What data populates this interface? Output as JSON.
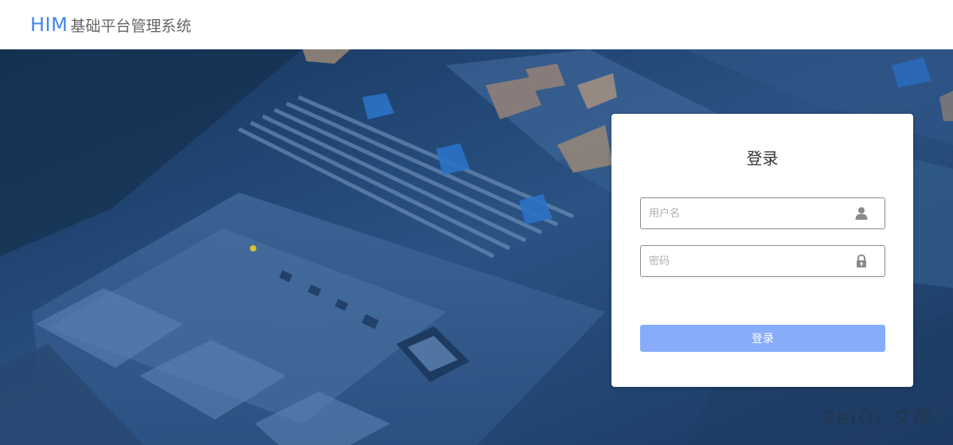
{
  "header": {
    "brand_abbr": "HIM",
    "brand_name": "基础平台管理系统"
  },
  "login": {
    "title": "登录",
    "username": {
      "value": "",
      "placeholder": "用户名",
      "icon": "user-icon"
    },
    "password": {
      "value": "",
      "placeholder": "密码",
      "icon": "lock-icon"
    },
    "submit_label": "登录"
  },
  "watermark": "PeiQi 文库",
  "colors": {
    "brand": "#3f85f0",
    "button": "#86acfa",
    "hero_bg": "#244a78"
  }
}
